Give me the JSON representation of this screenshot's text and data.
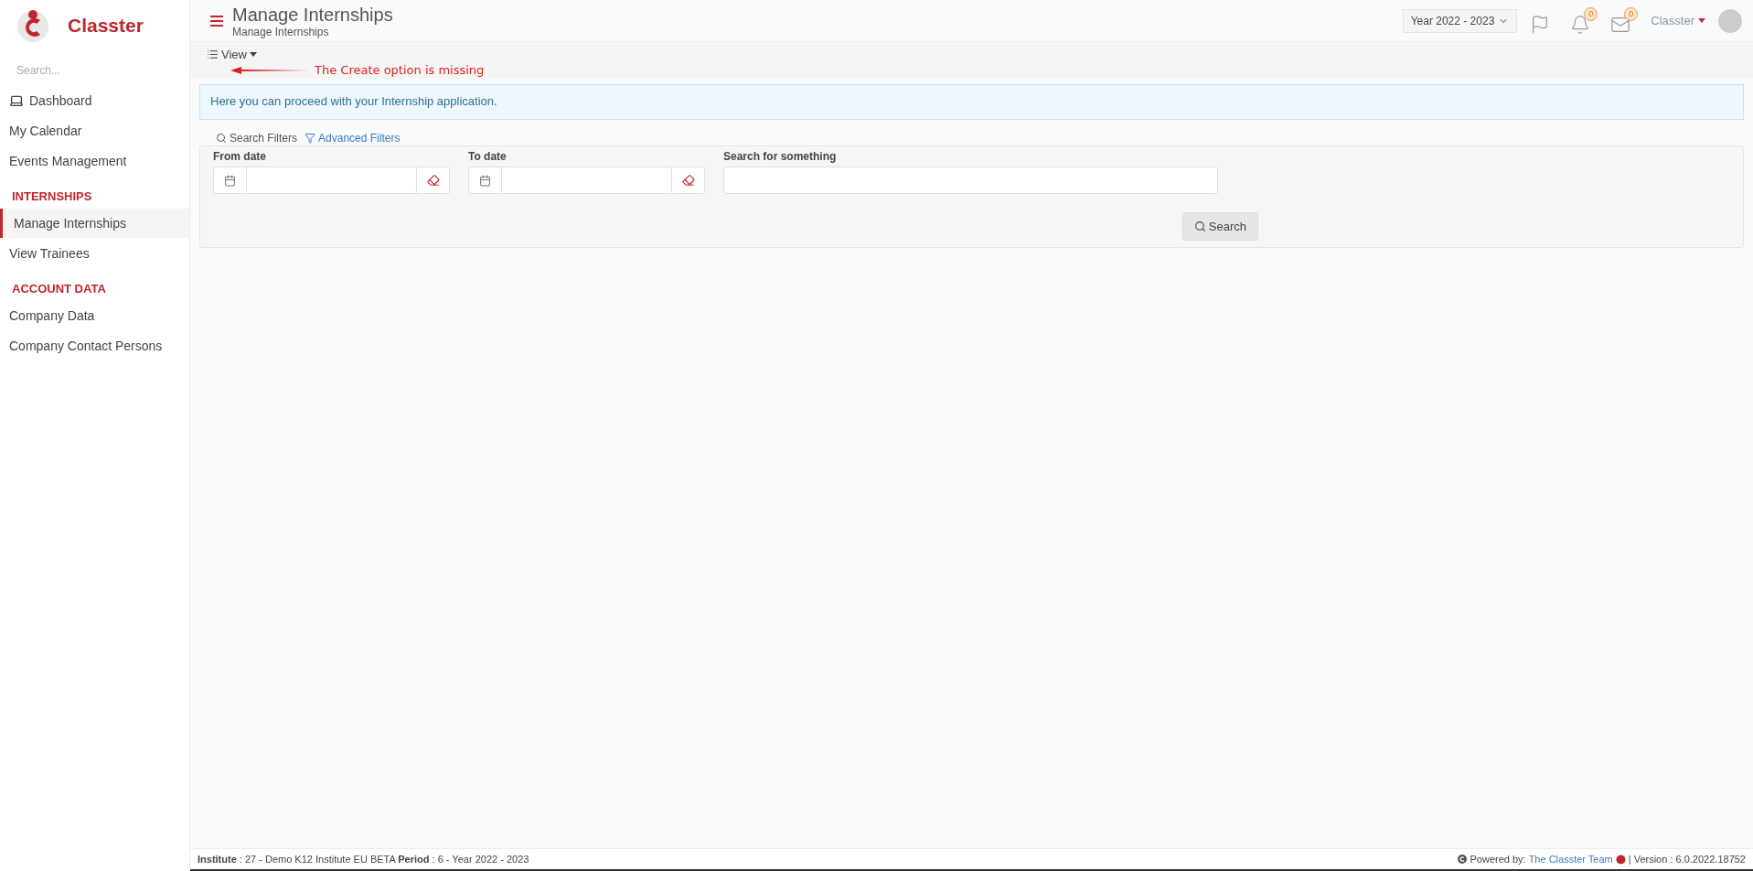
{
  "brand": {
    "name": "Classter"
  },
  "sidebar": {
    "search": {
      "placeholder": "Search..."
    },
    "items": [
      {
        "kind": "icon-item",
        "label": "Dashboard",
        "selected": false
      },
      {
        "kind": "item",
        "label": "My Calendar",
        "selected": false
      },
      {
        "kind": "item",
        "label": "Events Management",
        "selected": false
      },
      {
        "kind": "header",
        "label": "INTERNSHIPS"
      },
      {
        "kind": "item",
        "label": "Manage Internships",
        "selected": true
      },
      {
        "kind": "item",
        "label": "View Trainees",
        "selected": false
      },
      {
        "kind": "header",
        "label": "ACCOUNT DATA"
      },
      {
        "kind": "item",
        "label": "Company Data",
        "selected": false
      },
      {
        "kind": "item",
        "label": "Company Contact Persons",
        "selected": false
      }
    ]
  },
  "header": {
    "title": "Manage Internships",
    "breadcrumb": "Manage Internships",
    "year_select": "Year 2022 - 2023",
    "notifications_badge": "0",
    "messages_badge": "0",
    "user": "Classter"
  },
  "toolbar": {
    "view_button": "View"
  },
  "annotation": {
    "text": "The Create option is missing"
  },
  "info": "Here you can proceed with your Internship application.",
  "filters": {
    "tabs": [
      {
        "label": "Search Filters",
        "kind": "search",
        "selected": true
      },
      {
        "label": "Advanced Filters",
        "kind": "advanced",
        "selected": false
      }
    ],
    "fields": [
      {
        "kind": "date",
        "label": "From date"
      },
      {
        "kind": "date",
        "label": "To date"
      },
      {
        "kind": "text",
        "label": "Search for something"
      }
    ],
    "search_button": "Search"
  },
  "footer": {
    "left": "**Institute** : 27 - Demo K12 Institute EU BETA **Period** : 6 - Year 2022 - 2023",
    "powered": "Powered by:",
    "team_link": "The Classter Team",
    "version": "| Version : 6.0.2022.18752"
  }
}
